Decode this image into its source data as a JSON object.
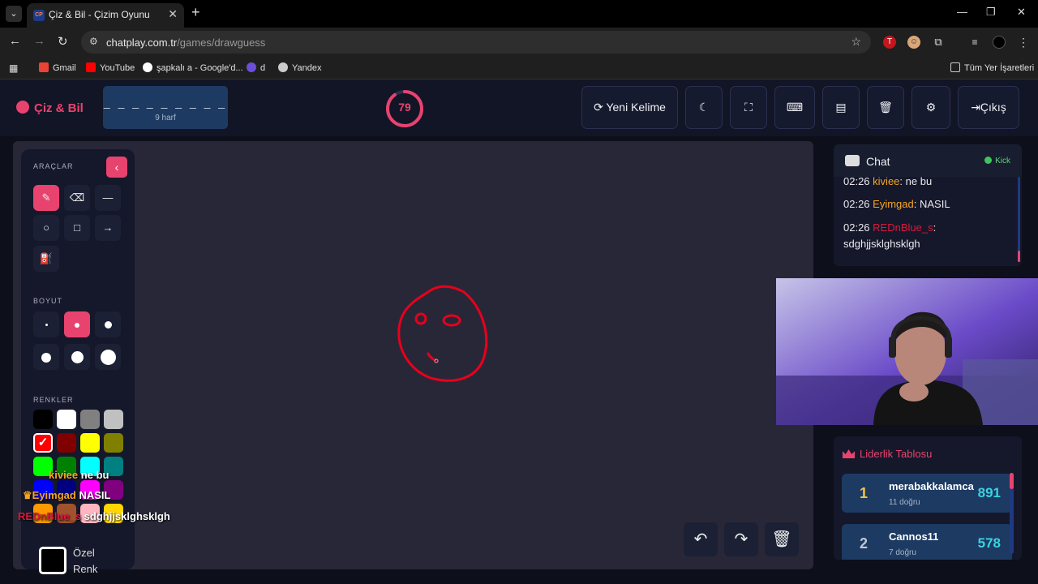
{
  "browser": {
    "tab_title": "Çiz & Bil - Çizim Oyunu",
    "tab_favicon": "CP",
    "url_host": "chatplay.com.tr",
    "url_path": "/games/drawguess",
    "bookmarks": [
      {
        "label": "Gmail",
        "icon": "gmail-icon",
        "color": "#ea4335"
      },
      {
        "label": "YouTube",
        "icon": "youtube-icon",
        "color": "#ff0000"
      },
      {
        "label": "şapkalı a - Google'd...",
        "icon": "google-icon",
        "color": "#ffffff"
      },
      {
        "label": "d",
        "icon": "game-icon",
        "color": "#6b4fd8"
      },
      {
        "label": "Yandex",
        "icon": "yandex-icon",
        "color": "#cccccc"
      }
    ],
    "all_bookmarks": "Tüm Yer İşaretleri"
  },
  "header": {
    "logo": "Çiz & Bil",
    "word_pattern": "_ _ _ _ _ _ _ _ _",
    "word_hint": "9 harf",
    "timer_value": "79",
    "timer_fraction": 0.9,
    "new_word": "Yeni Kelime",
    "exit": "Çıkış"
  },
  "tools": {
    "section_tools": "ARAÇLAR",
    "section_size": "BOYUT",
    "section_colors": "RENKLER",
    "custom_color": [
      "Özel",
      "Renk"
    ],
    "active_tool": "brush",
    "active_size_index": 1,
    "colors": [
      "#000000",
      "#ffffff",
      "#808080",
      "#c0c0c0",
      "#ff0000",
      "#800000",
      "#ffff00",
      "#808000",
      "#00ff00",
      "#008000",
      "#00ffff",
      "#008080",
      "#0000ff",
      "#000080",
      "#ff00ff",
      "#800080",
      "#ff9900",
      "#a0522d",
      "#ffb6c1",
      "#ffd700"
    ],
    "selected_color_index": 4
  },
  "overlay_chat": [
    {
      "user": "kiviee",
      "text": "ne bu",
      "color": "#f5a623"
    },
    {
      "user": "Eyimgad",
      "text": "NASIL",
      "color": "#f5a623"
    },
    {
      "user": "REDnBlue_s",
      "text": "sdghjjsklghsklgh",
      "color": "#d91a3c"
    }
  ],
  "chat": {
    "title": "Chat",
    "status": "Kick",
    "messages": [
      {
        "time": "02:26",
        "user": "kiviee",
        "text": ": ne bu",
        "color": "#f5a623"
      },
      {
        "time": "02:26",
        "user": "Eyimgad",
        "text": ": NASIL",
        "color": "#f5a623"
      },
      {
        "time": "02:26",
        "user": "REDnBlue_s",
        "text": ":",
        "color": "#d91a3c",
        "continuation": "sdghjjsklghsklgh"
      }
    ]
  },
  "leaderboard": {
    "title": "Liderlik Tablosu",
    "rows": [
      {
        "rank": "1",
        "name": "merabakkalamca",
        "sub": "11 doğru",
        "score": "891",
        "rank_color": "#f5c542"
      },
      {
        "rank": "2",
        "name": "Cannos11",
        "sub": "7 doğru",
        "score": "578",
        "rank_color": "#c0c8d8"
      }
    ]
  }
}
